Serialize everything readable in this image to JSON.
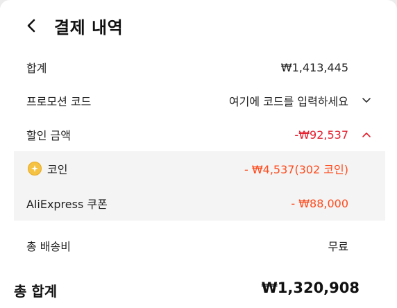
{
  "header": {
    "title": "결제 내역"
  },
  "subtotal": {
    "label": "합계",
    "value": "₩1,413,445"
  },
  "promo": {
    "label": "프로모션 코드",
    "placeholder": "여기에 코드를 입력하세요"
  },
  "discount": {
    "label": "할인 금액",
    "value": "-₩92,537",
    "items": [
      {
        "label": "코인",
        "value": "- ₩4,537(302 코인)"
      },
      {
        "label": "AliExpress 쿠폰",
        "value": "- ₩88,000"
      }
    ]
  },
  "shipping": {
    "label": "총 배송비",
    "value": "무료"
  },
  "total": {
    "label": "총 합계",
    "value": "₩1,320,908"
  },
  "colors": {
    "discount_red": "#e41d2d",
    "coupon_orange": "#ff4a1c",
    "coin_gold": "#f5c243"
  }
}
